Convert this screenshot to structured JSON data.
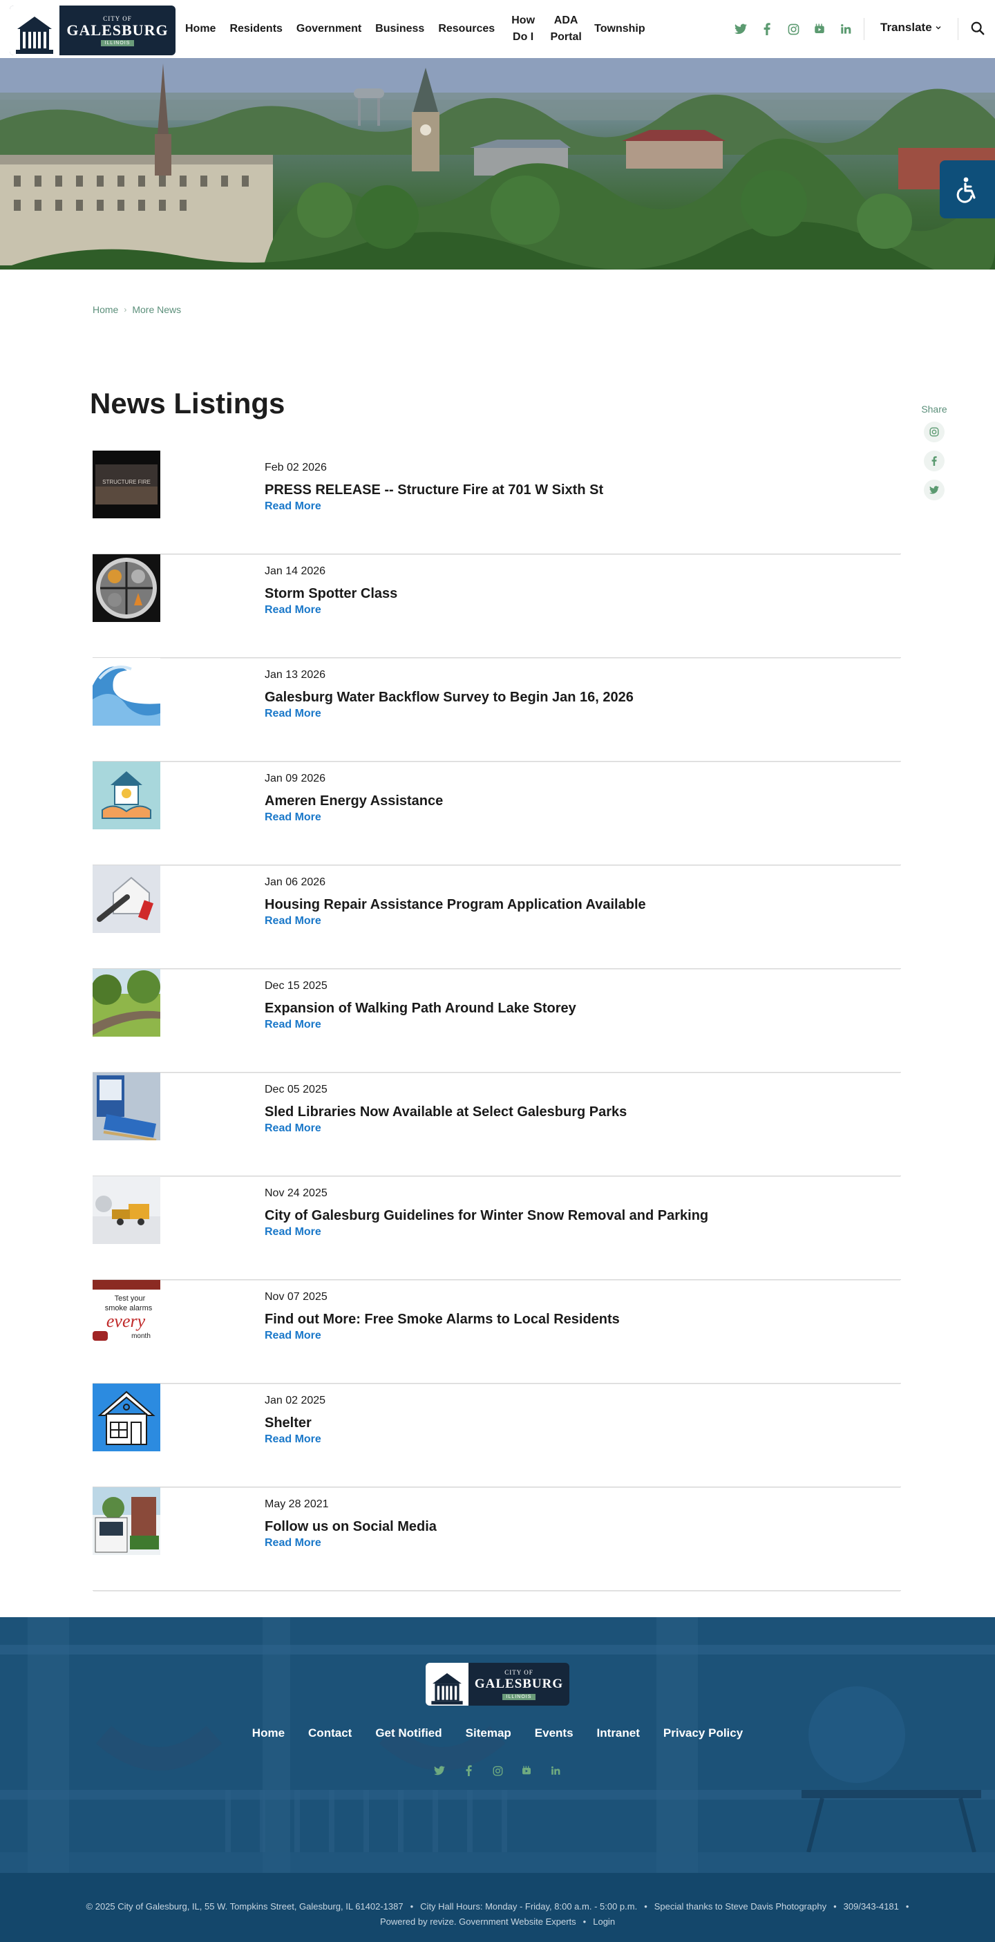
{
  "header": {
    "logo": {
      "city": "CITY OF",
      "name": "GALESBURG",
      "state": "ILLINOIS"
    },
    "nav": [
      {
        "label": "Home"
      },
      {
        "label": "Residents"
      },
      {
        "label": "Government"
      },
      {
        "label": "Business"
      },
      {
        "label": "Resources"
      },
      {
        "label": "How Do I"
      },
      {
        "label": "ADA Portal"
      },
      {
        "label": "Township"
      }
    ],
    "socials": [
      "twitter-icon",
      "facebook-icon",
      "instagram-icon",
      "youtube-icon",
      "linkedin-icon"
    ],
    "translate_label": "Translate",
    "accent_color": "#5b9a70"
  },
  "breadcrumb": {
    "home": "Home",
    "current": "More News"
  },
  "main": {
    "title": "News Listings",
    "share_label": "Share",
    "share_icons": [
      "instagram-icon",
      "facebook-icon",
      "twitter-icon"
    ],
    "read_more_label": "Read More",
    "news": [
      {
        "date": "Feb 02 2026",
        "title": "PRESS RELEASE -- Structure Fire at 701 W Sixth St",
        "thumb": "fire"
      },
      {
        "date": "Jan 14 2026",
        "title": "Storm Spotter Class",
        "thumb": "spotter"
      },
      {
        "date": "Jan 13 2026",
        "title": "Galesburg Water Backflow Survey to Begin Jan 16, 2026",
        "thumb": "water"
      },
      {
        "date": "Jan 09 2026",
        "title": "Ameren Energy Assistance",
        "thumb": "energy"
      },
      {
        "date": "Jan 06 2026",
        "title": "Housing Repair Assistance Program Application Available",
        "thumb": "repair"
      },
      {
        "date": "Dec 15 2025",
        "title": "Expansion of Walking Path Around Lake Storey",
        "thumb": "path"
      },
      {
        "date": "Dec 05 2025",
        "title": "Sled Libraries Now Available at Select Galesburg Parks",
        "thumb": "sled"
      },
      {
        "date": "Nov 24 2025",
        "title": "City of Galesburg Guidelines for Winter Snow Removal and Parking",
        "thumb": "snow"
      },
      {
        "date": "Nov 07 2025",
        "title": "Find out More:  Free Smoke Alarms to Local Residents",
        "thumb": "smoke"
      },
      {
        "date": "Jan 02 2025",
        "title": "Shelter",
        "thumb": "shelter"
      },
      {
        "date": "May 28 2021",
        "title": "Follow us on Social Media",
        "thumb": "social"
      }
    ]
  },
  "footer": {
    "links": [
      "Home",
      "Contact",
      "Get Notified",
      "Sitemap",
      "Events",
      "Intranet",
      "Privacy Policy"
    ],
    "socials": [
      "twitter-icon",
      "facebook-icon",
      "instagram-icon",
      "youtube-icon",
      "linkedin-icon"
    ],
    "copyright": "© 2025 City of Galesburg, IL, 55 W. Tompkins Street, Galesburg, IL 61402-1387",
    "hours": "City Hall Hours: Monday - Friday, 8:00 a.m. - 5:00 p.m.",
    "thanks": "Special thanks to Steve Davis Photography",
    "phone": "309/343-4181",
    "powered": "Powered by revize. Government Website Experts",
    "login": "Login"
  },
  "thumb_text": {
    "fire": "STRUCTURE FIRE",
    "smoke_1": "Test your",
    "smoke_2": "smoke alarms",
    "smoke_3": "every",
    "smoke_4": "month"
  }
}
